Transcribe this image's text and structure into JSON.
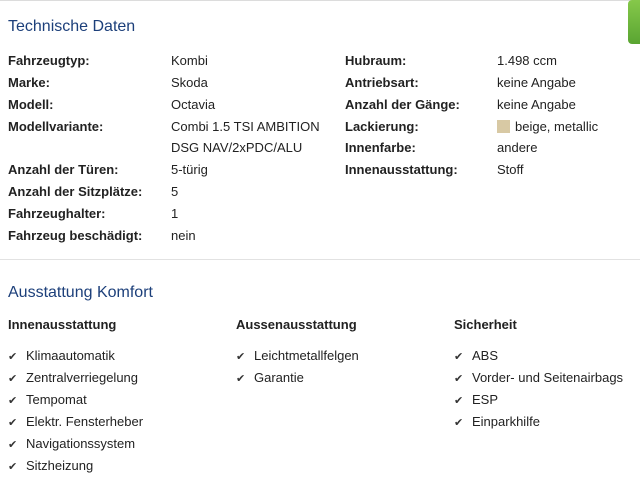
{
  "technical": {
    "title": "Technische Daten",
    "left": [
      {
        "label": "Fahrzeugtyp:",
        "value": "Kombi"
      },
      {
        "label": "Marke:",
        "value": "Skoda"
      },
      {
        "label": "Modell:",
        "value": "Octavia"
      },
      {
        "label": "Modellvariante:",
        "value": "Combi 1.5 TSI AMBITION",
        "value2": "DSG NAV/2xPDC/ALU"
      },
      {
        "label": "Anzahl der Türen:",
        "value": "5-türig"
      },
      {
        "label": "Anzahl der Sitzplätze:",
        "value": "5"
      },
      {
        "label": "Fahrzeughalter:",
        "value": "1"
      },
      {
        "label": "Fahrzeug beschädigt:",
        "value": "nein"
      }
    ],
    "right": [
      {
        "label": "Hubraum:",
        "value": "1.498 ccm"
      },
      {
        "label": "Antriebsart:",
        "value": "keine Angabe"
      },
      {
        "label": "Anzahl der Gänge:",
        "value": "keine Angabe"
      },
      {
        "label": "Lackierung:",
        "value": "beige, metallic",
        "swatch_color": "#d8c9a4"
      },
      {
        "label": "Innenfarbe:",
        "value": "andere"
      },
      {
        "label": "Innenausstattung:",
        "value": "Stoff"
      }
    ]
  },
  "comfort": {
    "title": "Ausstattung Komfort",
    "columns": [
      {
        "heading": "Innenausstattung",
        "items": [
          "Klimaautomatik",
          "Zentralverriegelung",
          "Tempomat",
          "Elektr. Fensterheber",
          "Navigationssystem",
          "Sitzheizung"
        ]
      },
      {
        "heading": "Aussenausstattung",
        "items": [
          "Leichtmetallfelgen",
          "Garantie"
        ]
      },
      {
        "heading": "Sicherheit",
        "items": [
          "ABS",
          "Vorder- und Seitenairbags",
          "ESP",
          "Einparkhilfe"
        ]
      }
    ]
  },
  "colors": {
    "title": "#1c3f7a",
    "accent_tab": "#6cb63c"
  },
  "icons": {
    "check": "check-icon"
  }
}
